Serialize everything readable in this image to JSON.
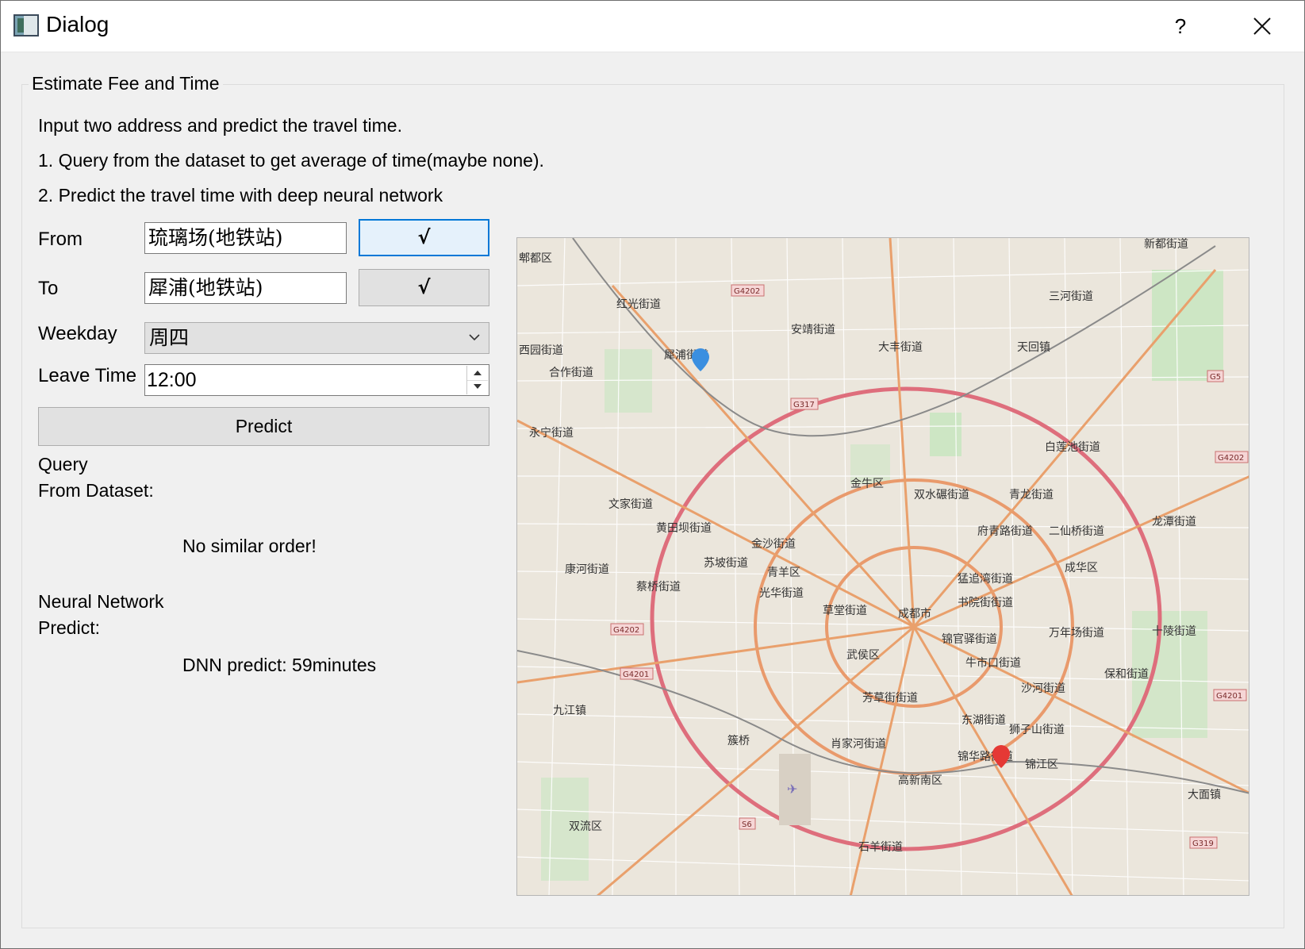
{
  "window": {
    "title": "Dialog",
    "help_label": "?"
  },
  "group": {
    "title": "Estimate Fee and Time",
    "intro": [
      "Input two address and predict the travel time.",
      "1. Query from the dataset to get average of time(maybe none).",
      "2. Predict the travel time with deep neural network"
    ]
  },
  "form": {
    "from_label": "From",
    "from_value": "琉璃场(地铁站)",
    "from_check": "√",
    "to_label": "To",
    "to_value": "犀浦(地铁站)",
    "to_check": "√",
    "weekday_label": "Weekday",
    "weekday_value": "周四",
    "leave_time_label": "Leave Time",
    "leave_time_value": "12:00",
    "predict_label": "Predict"
  },
  "results": {
    "query_label_1": "Query",
    "query_label_2": "From Dataset:",
    "query_result": "No similar order!",
    "nn_label_1": "Neural Network",
    "nn_label_2": "Predict:",
    "nn_result": "DNN predict: 59minutes"
  },
  "map": {
    "labels": [
      "郫都区",
      "新都街道",
      "红光街道",
      "三河街道",
      "犀浦街道",
      "安靖街道",
      "大丰街道",
      "天回镇",
      "西园街道",
      "合作街道",
      "永宁街道",
      "白莲池街道",
      "金牛区",
      "双水碾街道",
      "青龙街道",
      "文家街道",
      "黄田坝街道",
      "金沙街道",
      "府青路街道",
      "二仙桥街道",
      "龙潭街道",
      "康河街道",
      "苏坡街道",
      "青羊区",
      "蔡桥街道",
      "光华街道",
      "成华区",
      "猛追湾街道",
      "草堂街道",
      "成都市",
      "书院街街道",
      "万年场街道",
      "十陵街道",
      "锦官驿街道",
      "武侯区",
      "牛市口街道",
      "保和街道",
      "沙河街道",
      "九江镇",
      "芳草街街道",
      "东湖街道",
      "狮子山街道",
      "簇桥",
      "肖家河街道",
      "锦华路街道",
      "锦江区",
      "高新南区",
      "大面镇",
      "双流区",
      "石羊街道"
    ],
    "road_tags": [
      "G4202",
      "G317",
      "G5",
      "G4202",
      "G4202",
      "G4201",
      "S6",
      "G319",
      "G4201"
    ],
    "marker_colors": {
      "origin": "#3b8fe0",
      "destination": "#e53935"
    }
  }
}
